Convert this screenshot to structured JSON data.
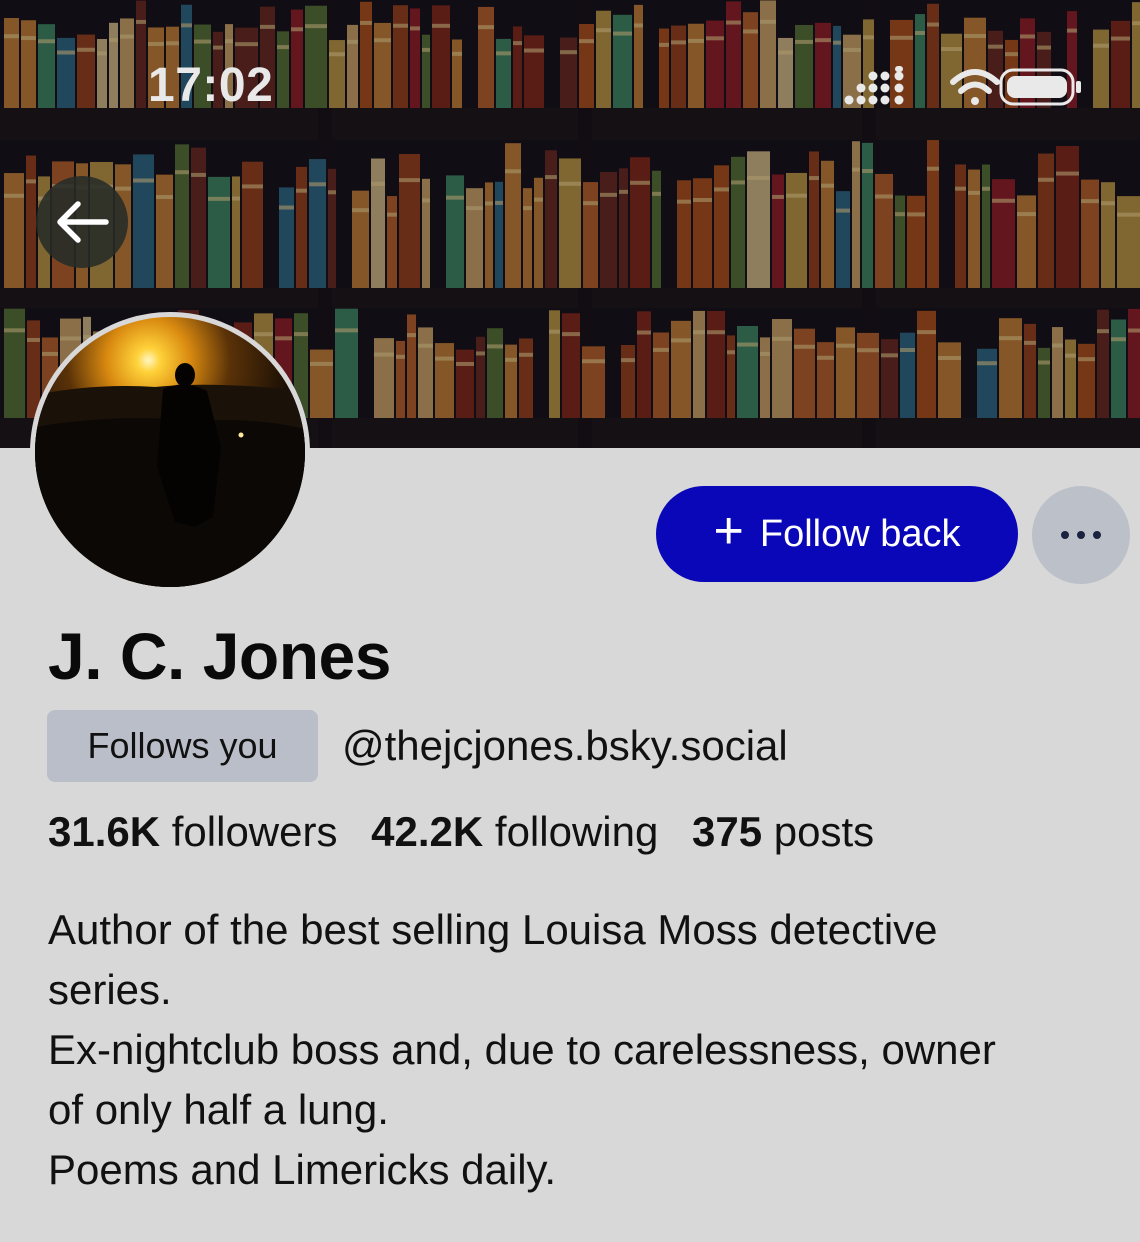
{
  "status_bar": {
    "time": "17:02",
    "icons": [
      "signal-icon",
      "wifi-icon",
      "battery-icon"
    ]
  },
  "header": {
    "back_icon": "back-arrow-icon"
  },
  "actions": {
    "follow_label": "Follow back",
    "follow_icon": "plus-icon",
    "more_icon": "ellipsis-icon"
  },
  "profile": {
    "display_name": "J. C. Jones",
    "follows_you_badge": "Follows you",
    "handle": "@thejcjones.bsky.social",
    "stats": {
      "followers_count": "31.6K",
      "followers_label": "followers",
      "following_count": "42.2K",
      "following_label": "following",
      "posts_count": "375",
      "posts_label": "posts"
    },
    "bio_lines": [
      "Author of the best selling Louisa Moss detective",
      "series.",
      "Ex-nightclub boss and, due to carelessness, owner",
      "of only half a lung.",
      "Poems and Limericks daily."
    ]
  },
  "colors": {
    "background": "#d8d8d8",
    "follow_button": "#0a07b8",
    "badge_background": "#b9bec8",
    "more_button": "#bcc0c8"
  }
}
